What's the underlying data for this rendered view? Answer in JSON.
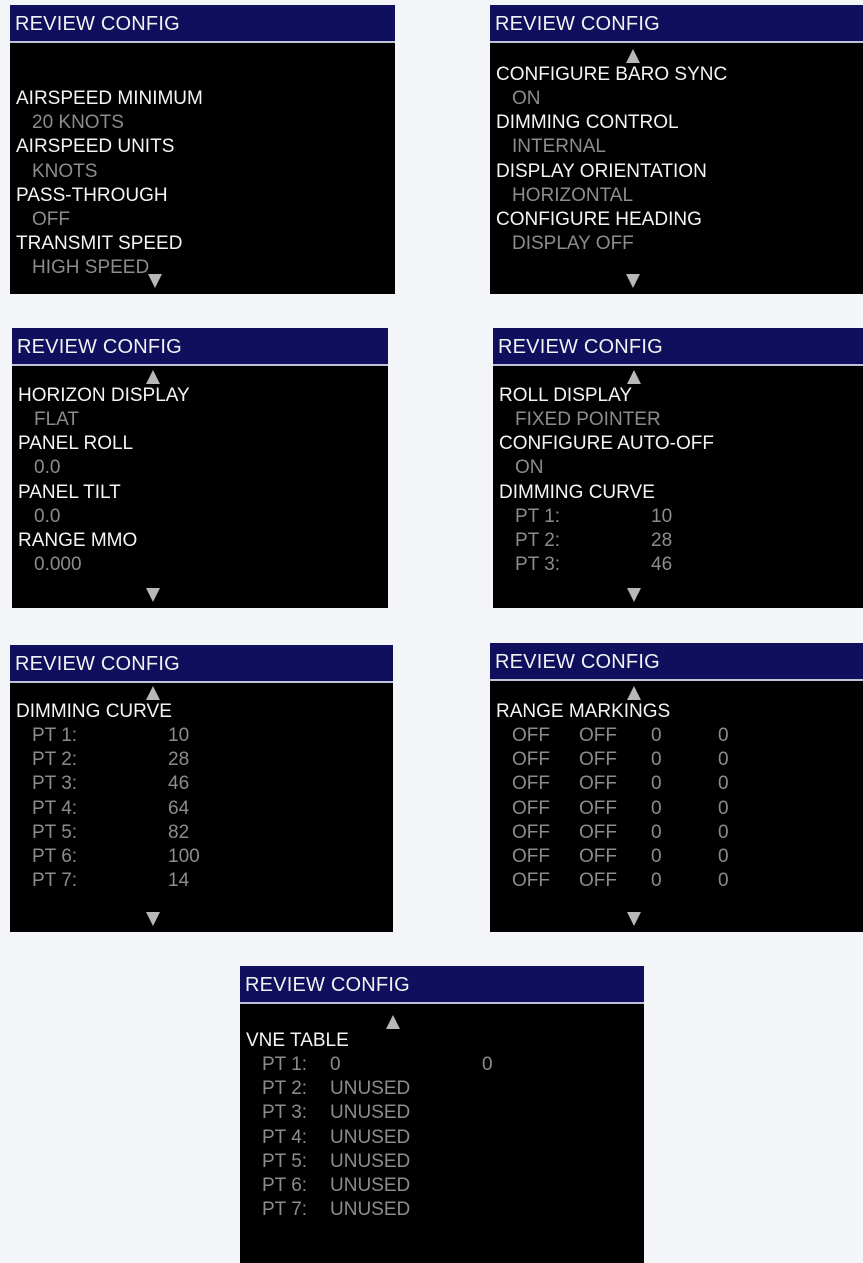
{
  "screens": [
    {
      "title": "REVIEW CONFIG",
      "rows": [
        {
          "type": "header",
          "text": ""
        },
        {
          "type": "header",
          "text": "AIRSPEED MINIMUM"
        },
        {
          "type": "value",
          "text": "20 KNOTS"
        },
        {
          "type": "header",
          "text": "AIRSPEED UNITS"
        },
        {
          "type": "value",
          "text": "KNOTS"
        },
        {
          "type": "header",
          "text": "PASS-THROUGH"
        },
        {
          "type": "value",
          "text": "OFF"
        },
        {
          "type": "header",
          "text": "TRANSMIT SPEED"
        },
        {
          "type": "value",
          "text": "HIGH SPEED"
        }
      ],
      "scroll_up": false,
      "scroll_down": true
    },
    {
      "title": "REVIEW CONFIG",
      "rows": [
        {
          "type": "header",
          "text": "CONFIGURE BARO SYNC"
        },
        {
          "type": "value",
          "text": "ON"
        },
        {
          "type": "header",
          "text": "DIMMING CONTROL"
        },
        {
          "type": "value",
          "text": "INTERNAL"
        },
        {
          "type": "header",
          "text": "DISPLAY ORIENTATION"
        },
        {
          "type": "value",
          "text": "HORIZONTAL"
        },
        {
          "type": "header",
          "text": "CONFIGURE HEADING"
        },
        {
          "type": "value",
          "text": "DISPLAY OFF"
        }
      ],
      "scroll_up": true,
      "scroll_down": true
    },
    {
      "title": "REVIEW CONFIG",
      "rows": [
        {
          "type": "header",
          "text": "HORIZON DISPLAY"
        },
        {
          "type": "value",
          "text": "FLAT"
        },
        {
          "type": "header",
          "text": "PANEL ROLL"
        },
        {
          "type": "value",
          "text": "0.0"
        },
        {
          "type": "header",
          "text": "PANEL TILT"
        },
        {
          "type": "value",
          "text": "0.0"
        },
        {
          "type": "header",
          "text": "RANGE MMO"
        },
        {
          "type": "value",
          "text": "0.000"
        }
      ],
      "scroll_up": true,
      "scroll_down": true
    },
    {
      "title": "REVIEW CONFIG",
      "rows": [
        {
          "type": "header",
          "text": "ROLL DISPLAY"
        },
        {
          "type": "value",
          "text": "FIXED POINTER"
        },
        {
          "type": "header",
          "text": "CONFIGURE AUTO-OFF"
        },
        {
          "type": "value",
          "text": "ON"
        },
        {
          "type": "header",
          "text": "DIMMING CURVE"
        },
        {
          "type": "pt",
          "cells": [
            "PT  1:",
            "10"
          ]
        },
        {
          "type": "pt",
          "cells": [
            "PT  2:",
            "28"
          ]
        },
        {
          "type": "pt",
          "cells": [
            "PT  3:",
            "46"
          ]
        }
      ],
      "scroll_up": true,
      "scroll_down": true
    },
    {
      "title": "REVIEW CONFIG",
      "rows": [
        {
          "type": "header",
          "text": "DIMMING CURVE"
        },
        {
          "type": "pt",
          "cells": [
            "PT  1:",
            "10"
          ]
        },
        {
          "type": "pt",
          "cells": [
            "PT  2:",
            "28"
          ]
        },
        {
          "type": "pt",
          "cells": [
            "PT  3:",
            "46"
          ]
        },
        {
          "type": "pt",
          "cells": [
            "PT  4:",
            "64"
          ]
        },
        {
          "type": "pt",
          "cells": [
            "PT  5:",
            "82"
          ]
        },
        {
          "type": "pt",
          "cells": [
            "PT  6:",
            "100"
          ]
        },
        {
          "type": "pt",
          "cells": [
            "PT  7:",
            "14"
          ]
        }
      ],
      "scroll_up": true,
      "scroll_down": true
    },
    {
      "title": "REVIEW CONFIG",
      "rows": [
        {
          "type": "header",
          "text": "RANGE MARKINGS"
        },
        {
          "type": "range",
          "cells": [
            "OFF",
            "OFF",
            "0",
            "0"
          ]
        },
        {
          "type": "range",
          "cells": [
            "OFF",
            "OFF",
            "0",
            "0"
          ]
        },
        {
          "type": "range",
          "cells": [
            "OFF",
            "OFF",
            "0",
            "0"
          ]
        },
        {
          "type": "range",
          "cells": [
            "OFF",
            "OFF",
            "0",
            "0"
          ]
        },
        {
          "type": "range",
          "cells": [
            "OFF",
            "OFF",
            "0",
            "0"
          ]
        },
        {
          "type": "range",
          "cells": [
            "OFF",
            "OFF",
            "0",
            "0"
          ]
        },
        {
          "type": "range",
          "cells": [
            "OFF",
            "OFF",
            "0",
            "0"
          ]
        }
      ],
      "scroll_up": true,
      "scroll_down": true
    },
    {
      "title": "REVIEW CONFIG",
      "rows": [
        {
          "type": "header",
          "text": "VNE TABLE"
        },
        {
          "type": "vne",
          "cells": [
            "PT  1:",
            "0",
            "0"
          ]
        },
        {
          "type": "vne",
          "cells": [
            "PT  2:",
            "UNUSED"
          ]
        },
        {
          "type": "vne",
          "cells": [
            "PT  3:",
            "UNUSED"
          ]
        },
        {
          "type": "vne",
          "cells": [
            "PT  4:",
            "UNUSED"
          ]
        },
        {
          "type": "vne",
          "cells": [
            "PT  5:",
            "UNUSED"
          ]
        },
        {
          "type": "vne",
          "cells": [
            "PT  6:",
            "UNUSED"
          ]
        },
        {
          "type": "vne",
          "cells": [
            "PT  7:",
            "UNUSED"
          ]
        }
      ],
      "scroll_up": true,
      "scroll_down": false
    }
  ]
}
